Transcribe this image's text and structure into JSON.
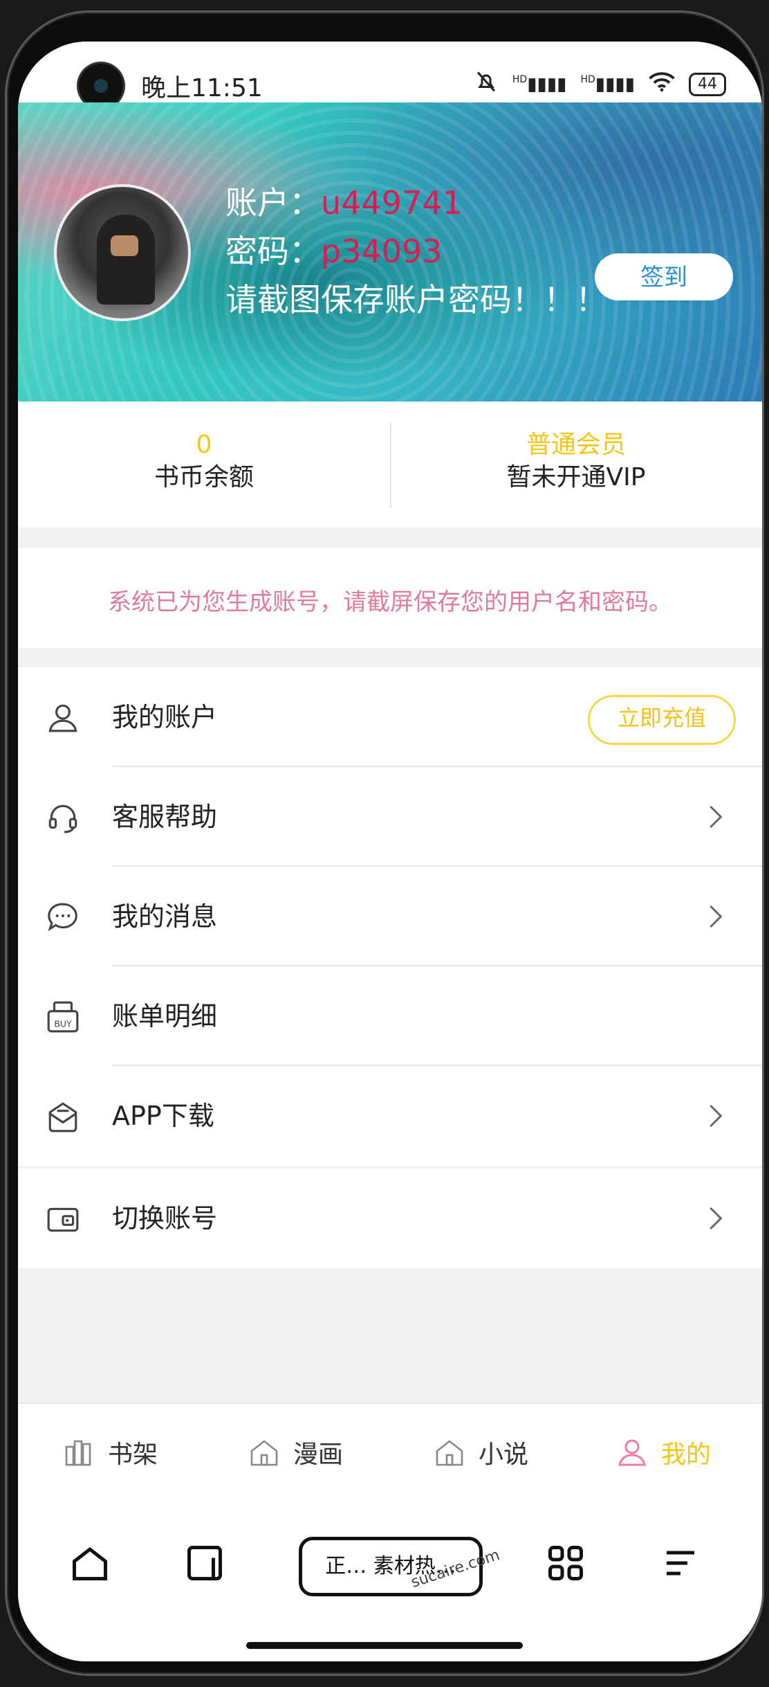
{
  "status_bar": {
    "time": "晚上11:51",
    "signal_label_1": "HD",
    "signal_label_2": "HD",
    "battery": "44"
  },
  "header": {
    "account_label": "账户：",
    "account_value": "u449741",
    "password_label": "密码：",
    "password_value": "p34093",
    "save_tip": "请截图保存账户密码！！！",
    "signin_label": "签到"
  },
  "stats": {
    "coins_value": "0",
    "coins_label": "书币余额",
    "member_level": "普通会员",
    "vip_status": "暂未开通VIP"
  },
  "notice": {
    "text": "系统已为您生成账号，请截屏保存您的用户名和密码。"
  },
  "menu": {
    "items": [
      {
        "label": "我的账户",
        "icon": "user-icon"
      },
      {
        "label": "客服帮助",
        "icon": "headset-icon"
      },
      {
        "label": "我的消息",
        "icon": "chat-icon"
      },
      {
        "label": "账单明细",
        "icon": "buy-bill-icon"
      },
      {
        "label": "APP下载",
        "icon": "download-icon"
      }
    ],
    "recharge_label": "立即充值"
  },
  "menu2": {
    "items": [
      {
        "label": "切换账号",
        "icon": "wallet-icon"
      }
    ]
  },
  "app_nav": {
    "tabs": [
      {
        "label": "书架",
        "icon": "bookshelf-icon"
      },
      {
        "label": "漫画",
        "icon": "house-icon"
      },
      {
        "label": "小说",
        "icon": "house-icon"
      },
      {
        "label": "我的",
        "icon": "user-icon",
        "active": true
      }
    ]
  },
  "browser_bar": {
    "url_text": "正… 素材热…",
    "watermark": "sucaire.com"
  },
  "colors": {
    "accent_yellow": "#f5c518",
    "credential_red": "#d81d52",
    "notice_pink": "#e07aa0",
    "signin_blue": "#2a8fd6"
  }
}
